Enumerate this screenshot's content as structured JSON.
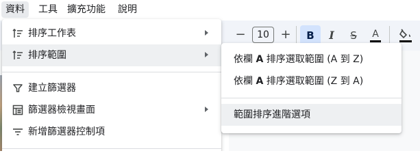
{
  "menubar": {
    "items": [
      {
        "label": "資料",
        "active": true
      },
      {
        "label": "工具"
      },
      {
        "label": "擴充功能"
      },
      {
        "label": "說明"
      }
    ]
  },
  "toolbar": {
    "font_size": "10",
    "minus": "−",
    "plus": "+",
    "bold": "B",
    "italic": "I",
    "strikethrough": "S",
    "text_color": "A",
    "text_color_value": "#000000"
  },
  "data_menu": {
    "items": [
      {
        "label": "排序工作表",
        "icon": "sort-icon",
        "has_submenu": true
      },
      {
        "label": "排序範圍",
        "icon": "sort-icon",
        "has_submenu": true,
        "highlighted": true
      },
      {
        "label": "建立篩選器",
        "icon": "filter-icon"
      },
      {
        "label": "篩選器檢視畫面",
        "icon": "filter-view-icon",
        "has_submenu": true
      },
      {
        "label": "新增篩選器控制項",
        "icon": "filter-control-icon"
      }
    ]
  },
  "sort_range_submenu": {
    "items": [
      {
        "prefix": "依欄",
        "column": "A",
        "suffix": "排序選取範圍 (A 到 Z)"
      },
      {
        "prefix": "依欄",
        "column": "A",
        "suffix": "排序選取範圍 (Z 到 A)"
      },
      {
        "label": "範圍排序進階選項",
        "highlighted": true
      }
    ]
  }
}
